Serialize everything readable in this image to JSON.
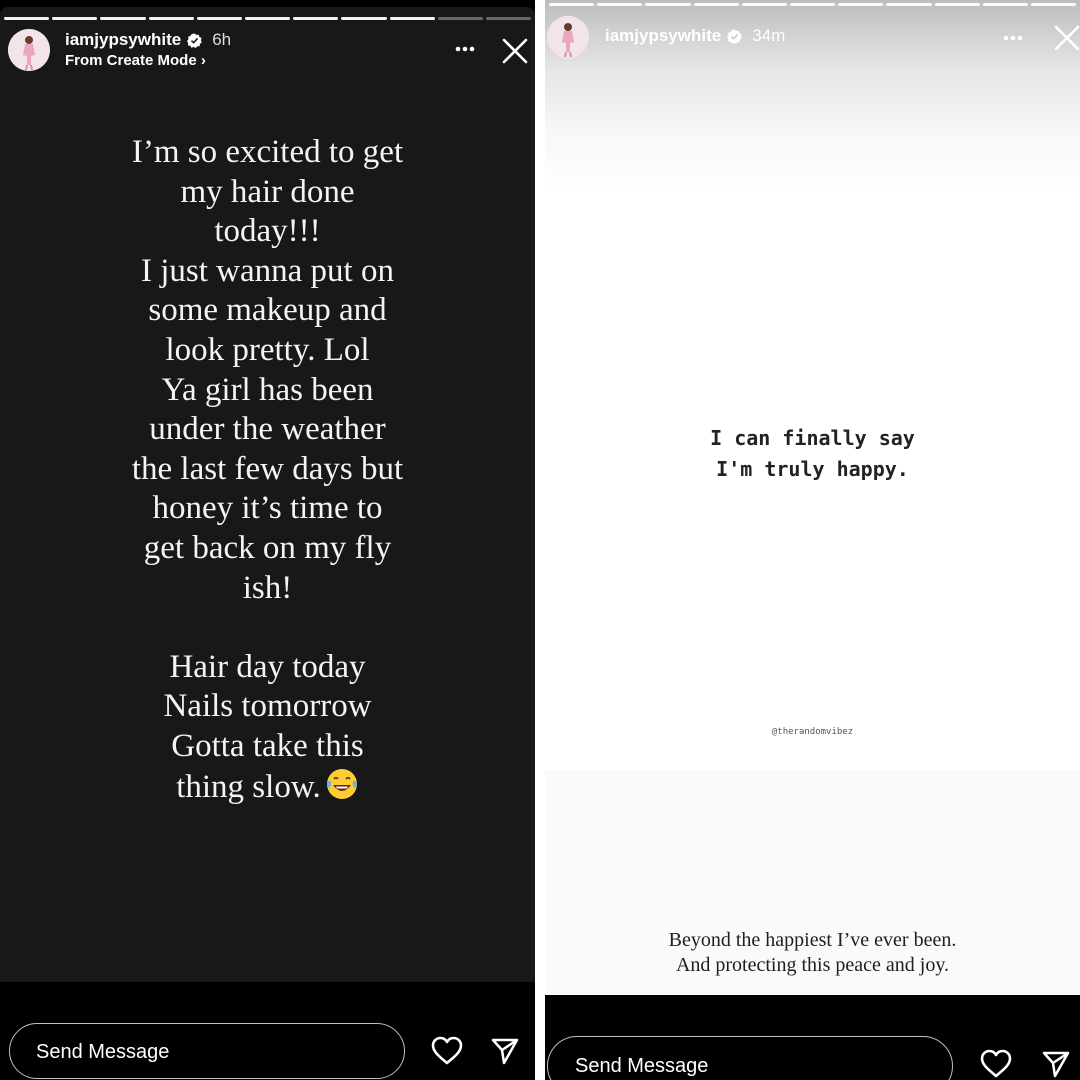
{
  "left_story": {
    "progress": {
      "segments": 11,
      "completed": 9
    },
    "header": {
      "username": "iamjypsywhite",
      "time": "6h",
      "subline": "From Create Mode ›",
      "more_icon": "more-horizontal-icon",
      "close_icon": "close-icon",
      "verified_icon": "verified-badge-icon"
    },
    "text_lines": [
      "I’m so excited to get",
      "my hair done",
      "today!!!",
      "I just wanna put on",
      "some makeup and",
      "look pretty. Lol",
      "Ya girl has been",
      "under the weather",
      "the last few days but",
      "honey it’s time to",
      "get back on my fly",
      "ish!",
      "",
      "Hair day today",
      "Nails tomorrow",
      "Gotta take this",
      "thing slow."
    ],
    "emoji": "tears-of-joy-emoji-icon",
    "bottom_bar": {
      "message_placeholder": "Send Message",
      "like_icon": "heart-icon",
      "share_icon": "send-icon"
    }
  },
  "right_story": {
    "progress": {
      "segments": 11,
      "completed": 11
    },
    "header": {
      "username": "iamjypsywhite",
      "time": "34m",
      "more_icon": "more-horizontal-icon",
      "close_icon": "close-icon",
      "verified_icon": "verified-badge-icon"
    },
    "quote_lines": [
      "I can finally say",
      "I'm truly happy."
    ],
    "credit": "@therandomvibez",
    "caption_lines": [
      "Beyond the happiest I’ve ever been.",
      "And protecting this peace and joy."
    ],
    "bottom_bar": {
      "message_placeholder": "Send Message",
      "like_icon": "heart-icon",
      "share_icon": "send-icon"
    }
  },
  "colors": {
    "left_story_bg": "#181818",
    "panel_bg": "#000000",
    "right_story_bg": "#ffffff",
    "verified_blue": "#ffffff"
  }
}
